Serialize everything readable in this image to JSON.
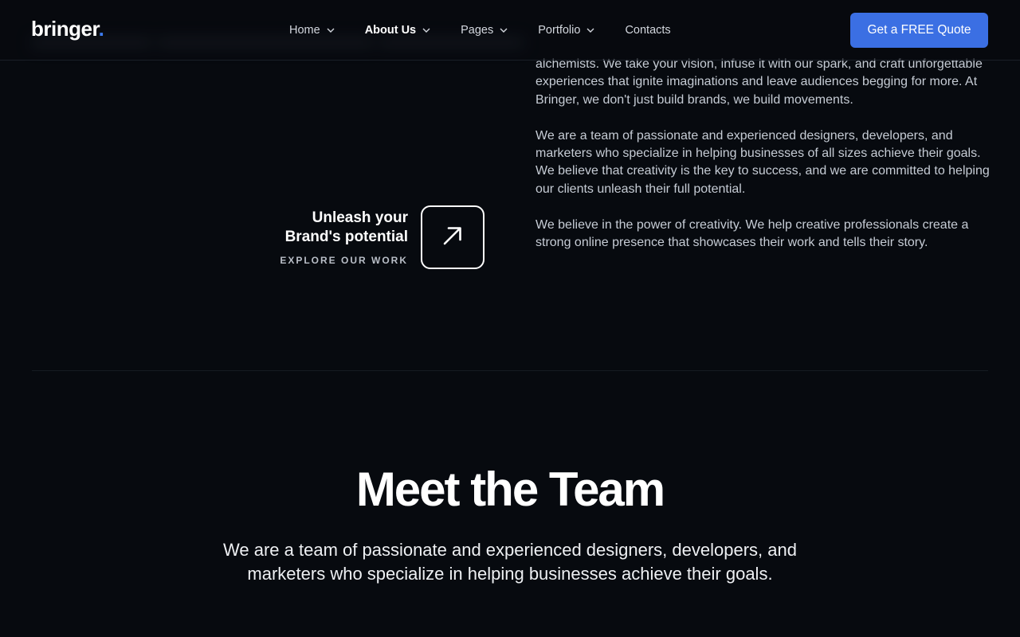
{
  "header": {
    "logo_text": "bringer",
    "logo_dot": ".",
    "nav": [
      {
        "label": "Home",
        "has_dropdown": true
      },
      {
        "label": "About Us",
        "has_dropdown": true,
        "active": true
      },
      {
        "label": "Pages",
        "has_dropdown": true
      },
      {
        "label": "Portfolio",
        "has_dropdown": true
      },
      {
        "label": "Contacts",
        "has_dropdown": false
      }
    ],
    "quote_button": "Get a FREE Quote"
  },
  "about": {
    "paragraphs": [
      "alchemists. We take your vision, infuse it with our spark, and craft unforgettable experiences that ignite imaginations and leave audiences begging for more. At Bringer, we don't just build brands, we build movements.",
      "We are a team of passionate and experienced designers, developers, and marketers who specialize in helping businesses of all sizes achieve their goals. We believe that creativity is the key to success, and we are committed to helping our clients unleash their full potential.",
      "We believe in the power of creativity. We help creative professionals create a strong online presence that showcases their work and tells their story."
    ]
  },
  "cta": {
    "title_line1": "Unleash your",
    "title_line2": "Brand's potential",
    "subtitle": "EXPLORE OUR WORK",
    "icon": "arrow-up-right-icon"
  },
  "team": {
    "title": "Meet the Team",
    "description": "We are a team of passionate and experienced designers, developers, and marketers who specialize in helping businesses achieve their goals."
  },
  "colors": {
    "background": "#070a0f",
    "accent": "#3b6fe3",
    "logo_dot": "#3d7bf0"
  }
}
